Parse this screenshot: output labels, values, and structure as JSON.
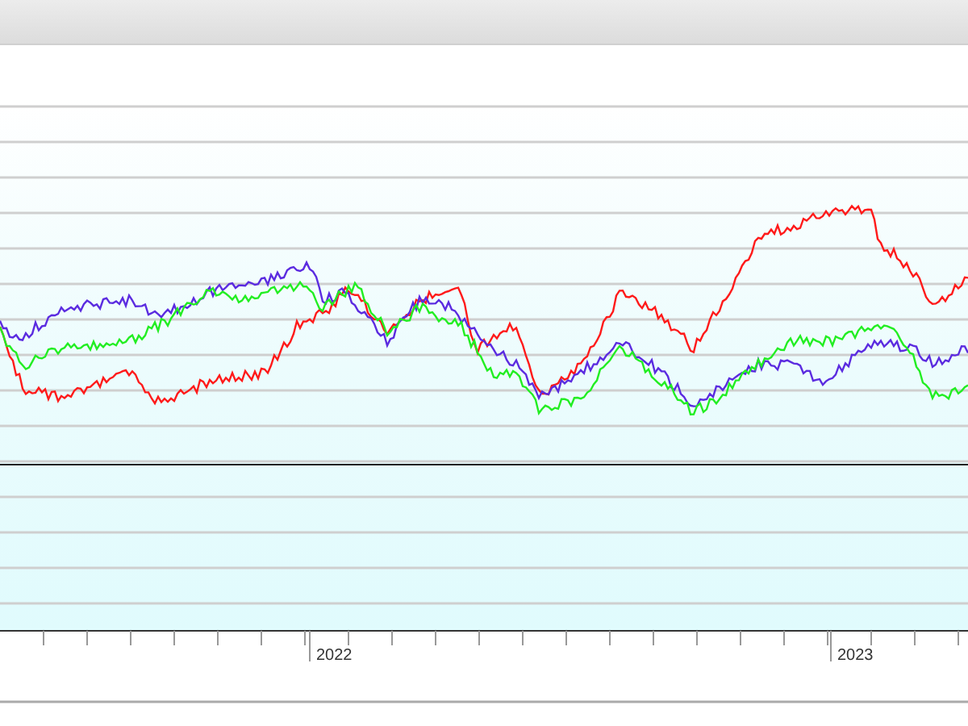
{
  "chart": {
    "series": [
      {
        "color": "#ff1a1a"
      },
      {
        "color": "#5b2be0"
      },
      {
        "color": "#22ee22"
      }
    ],
    "x_axis": {
      "labels": [
        {
          "text": "2022"
        },
        {
          "text": "2023"
        }
      ]
    }
  }
}
